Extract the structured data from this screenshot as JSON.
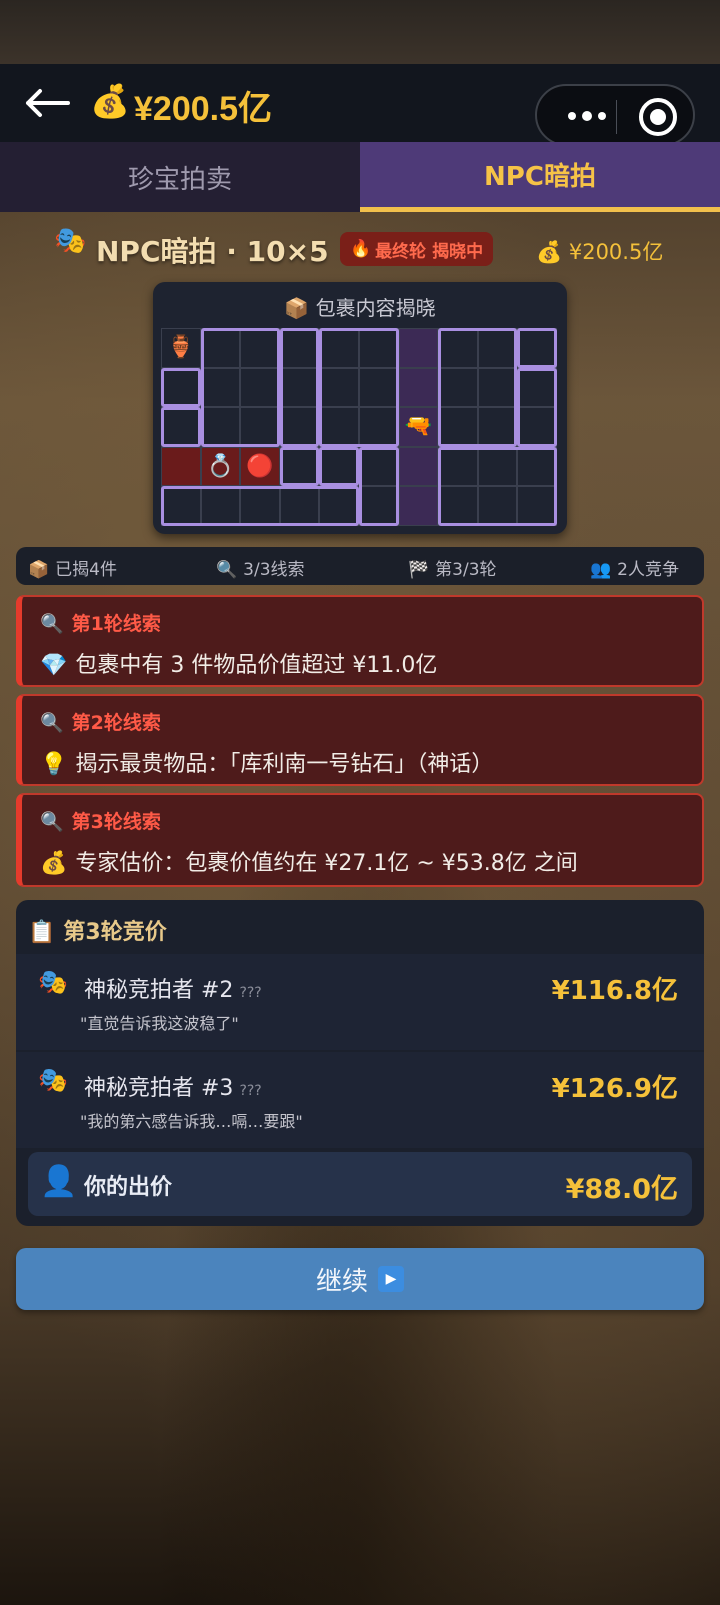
{
  "header": {
    "back_icon": "arrow-left-icon",
    "coin_icon": "💰",
    "balance": "¥200.5亿",
    "menu_icon": "more-dots-icon",
    "close_icon": "target-icon"
  },
  "tabs": [
    {
      "label": "珍宝拍卖",
      "active": false
    },
    {
      "label": "NPC暗拍",
      "active": true
    }
  ],
  "heading": {
    "icon": "🎭",
    "title": "NPC暗拍 · 10×5",
    "badge_icon": "🔥",
    "badge": "最终轮 揭晓中",
    "budget_icon": "💰",
    "budget": "¥200.5亿"
  },
  "reveal": {
    "icon": "📦",
    "title": "包裹内容揭晓",
    "cols": 10,
    "rows": 5
  },
  "stats": [
    {
      "icon": "📦",
      "text": "已揭4件"
    },
    {
      "icon": "🔍",
      "text": "3/3线索"
    },
    {
      "icon": "🏁",
      "text": "第3/3轮"
    },
    {
      "icon": "👥",
      "text": "2人竞争"
    }
  ],
  "clues": [
    {
      "icon": "🔍",
      "title": "第1轮线索",
      "text_icon": "💎",
      "text": "包裹中有 3 件物品价值超过 ¥11.0亿"
    },
    {
      "icon": "🔍",
      "title": "第2轮线索",
      "text_icon": "💡",
      "text": "揭示最贵物品：「库利南一号钻石」（神话）"
    },
    {
      "icon": "🔍",
      "title": "第3轮线索",
      "text_icon": "💰",
      "text": "专家估价：包裹价值约在 ¥27.1亿 ~ ¥53.8亿 之间"
    }
  ],
  "bidding": {
    "icon": "📋",
    "title": "第3轮竞价",
    "bidders": [
      {
        "icon": "🎭",
        "name": "神秘竞拍者 #2",
        "tag": "???",
        "quote": "\"直觉告诉我这波稳了\"",
        "amount": "¥116.8亿"
      },
      {
        "icon": "🎭",
        "name": "神秘竞拍者 #3",
        "tag": "???",
        "quote": "\"我的第六感告诉我…嗝…要跟\"",
        "amount": "¥126.9亿"
      }
    ],
    "mine": {
      "icon": "👤",
      "label": "你的出价",
      "amount": "¥88.0亿"
    }
  },
  "continue": {
    "label": "继续",
    "icon": "▶"
  }
}
